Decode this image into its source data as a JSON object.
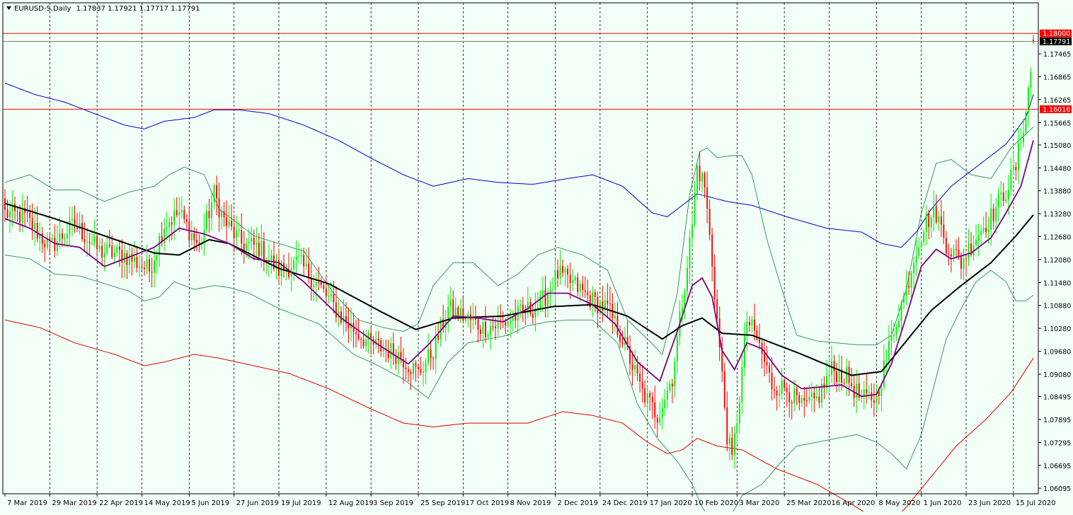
{
  "chart_data": {
    "type": "candlestick",
    "symbol_label": "EURUSD-S,Daily",
    "ohlc_header": "1.17837 1.17921 1.17717 1.17791",
    "ylim": [
      1.0595,
      1.188
    ],
    "y_ticks": [
      "1.17465",
      "1.16865",
      "1.16265",
      "1.15665",
      "1.15080",
      "1.14480",
      "1.13880",
      "1.13280",
      "1.12680",
      "1.12080",
      "1.11480",
      "1.10880",
      "1.10280",
      "1.09680",
      "1.09080",
      "1.08495",
      "1.07895",
      "1.07295",
      "1.06695",
      "1.06095"
    ],
    "x_ticks": [
      "7 Mar 2019",
      "29 Mar 2019",
      "22 Apr 2019",
      "14 May 2019",
      "5 Jun 2019",
      "27 Jun 2019",
      "19 Jul 2019",
      "12 Aug 2019",
      "3 Sep 2019",
      "25 Sep 2019",
      "17 Oct 2019",
      "8 Nov 2019",
      "2 Dec 2019",
      "24 Dec 2019",
      "17 Jan 2020",
      "10 Feb 2020",
      "3 Mar 2020",
      "25 Mar 2020",
      "16 Apr 2020",
      "8 May 2020",
      "1 Jun 2020",
      "23 Jun 2020",
      "15 Jul 2020"
    ],
    "price_levels": [
      {
        "value": 1.18,
        "label": "1.18000",
        "color": "#ff0000"
      },
      {
        "value": 1.16016,
        "label": "1.16016",
        "color": "#ff0000"
      }
    ],
    "current_price": {
      "value": 1.17791,
      "label": "1.17791",
      "color": "#808080"
    },
    "colors": {
      "background": "#f2fff6",
      "bull": "#00ee00",
      "bear": "#ff0000",
      "bollinger": "#2e8b57",
      "ma_fast": "#800080",
      "ma_slow": "#000000",
      "envelope_upper": "#0000cc",
      "envelope_lower": "#dd0000"
    },
    "anchors": [
      [
        0,
        1.133
      ],
      [
        8,
        1.132
      ],
      [
        18,
        1.124
      ],
      [
        28,
        1.13
      ],
      [
        38,
        1.123
      ],
      [
        48,
        1.122
      ],
      [
        58,
        1.118
      ],
      [
        64,
        1.13
      ],
      [
        70,
        1.133
      ],
      [
        78,
        1.124
      ],
      [
        84,
        1.138
      ],
      [
        88,
        1.131
      ],
      [
        95,
        1.125
      ],
      [
        102,
        1.124
      ],
      [
        110,
        1.118
      ],
      [
        118,
        1.12
      ],
      [
        126,
        1.114
      ],
      [
        136,
        1.105
      ],
      [
        146,
        1.099
      ],
      [
        158,
        1.096
      ],
      [
        166,
        1.091
      ],
      [
        172,
        1.097
      ],
      [
        178,
        1.108
      ],
      [
        184,
        1.106
      ],
      [
        192,
        1.103
      ],
      [
        200,
        1.104
      ],
      [
        208,
        1.107
      ],
      [
        215,
        1.109
      ],
      [
        222,
        1.117
      ],
      [
        229,
        1.114
      ],
      [
        236,
        1.11
      ],
      [
        242,
        1.108
      ],
      [
        248,
        1.1
      ],
      [
        256,
        1.086
      ],
      [
        262,
        1.08
      ],
      [
        268,
        1.09
      ],
      [
        272,
        1.11
      ],
      [
        276,
        1.13
      ],
      [
        278,
        1.145
      ],
      [
        281,
        1.14
      ],
      [
        284,
        1.12
      ],
      [
        288,
        1.09
      ],
      [
        290,
        1.075
      ],
      [
        292,
        1.068
      ],
      [
        295,
        1.085
      ],
      [
        298,
        1.105
      ],
      [
        302,
        1.1
      ],
      [
        308,
        1.088
      ],
      [
        314,
        1.087
      ],
      [
        320,
        1.082
      ],
      [
        326,
        1.084
      ],
      [
        332,
        1.092
      ],
      [
        338,
        1.09
      ],
      [
        344,
        1.084
      ],
      [
        350,
        1.085
      ],
      [
        354,
        1.095
      ],
      [
        358,
        1.105
      ],
      [
        362,
        1.113
      ],
      [
        366,
        1.124
      ],
      [
        370,
        1.131
      ],
      [
        374,
        1.133
      ],
      [
        378,
        1.125
      ],
      [
        384,
        1.12
      ],
      [
        390,
        1.127
      ],
      [
        396,
        1.132
      ],
      [
        402,
        1.139
      ],
      [
        406,
        1.145
      ],
      [
        410,
        1.16
      ],
      [
        412,
        1.17
      ],
      [
        413,
        1.1779
      ]
    ],
    "ma_fast_pts": [
      [
        0,
        1.1315
      ],
      [
        10,
        1.129
      ],
      [
        20,
        1.125
      ],
      [
        30,
        1.124
      ],
      [
        40,
        1.119
      ],
      [
        50,
        1.1215
      ],
      [
        60,
        1.124
      ],
      [
        70,
        1.129
      ],
      [
        80,
        1.1275
      ],
      [
        90,
        1.125
      ],
      [
        100,
        1.121
      ],
      [
        110,
        1.12
      ],
      [
        120,
        1.115
      ],
      [
        135,
        1.1055
      ],
      [
        150,
        1.0985
      ],
      [
        162,
        1.0935
      ],
      [
        170,
        1.0985
      ],
      [
        180,
        1.106
      ],
      [
        190,
        1.1055
      ],
      [
        200,
        1.1045
      ],
      [
        210,
        1.108
      ],
      [
        218,
        1.112
      ],
      [
        226,
        1.112
      ],
      [
        236,
        1.109
      ],
      [
        245,
        1.104
      ],
      [
        254,
        1.094
      ],
      [
        263,
        1.089
      ],
      [
        270,
        1.102
      ],
      [
        276,
        1.114
      ],
      [
        280,
        1.116
      ],
      [
        284,
        1.111
      ],
      [
        288,
        1.097
      ],
      [
        293,
        1.092
      ],
      [
        298,
        1.099
      ],
      [
        304,
        1.0975
      ],
      [
        312,
        1.0905
      ],
      [
        320,
        1.087
      ],
      [
        328,
        1.0875
      ],
      [
        336,
        1.088
      ],
      [
        344,
        1.085
      ],
      [
        350,
        1.0855
      ],
      [
        356,
        1.0935
      ],
      [
        362,
        1.106
      ],
      [
        368,
        1.119
      ],
      [
        374,
        1.1235
      ],
      [
        380,
        1.121
      ],
      [
        388,
        1.1225
      ],
      [
        396,
        1.1265
      ],
      [
        402,
        1.133
      ],
      [
        408,
        1.14
      ],
      [
        413,
        1.152
      ]
    ],
    "ma_slow_pts": [
      [
        0,
        1.1355
      ],
      [
        20,
        1.1315
      ],
      [
        40,
        1.127
      ],
      [
        60,
        1.1225
      ],
      [
        70,
        1.122
      ],
      [
        82,
        1.126
      ],
      [
        90,
        1.125
      ],
      [
        110,
        1.1185
      ],
      [
        130,
        1.1145
      ],
      [
        150,
        1.1075
      ],
      [
        165,
        1.1025
      ],
      [
        180,
        1.1055
      ],
      [
        200,
        1.106
      ],
      [
        220,
        1.1085
      ],
      [
        236,
        1.109
      ],
      [
        250,
        1.106
      ],
      [
        264,
        1.1
      ],
      [
        272,
        1.1035
      ],
      [
        280,
        1.1055
      ],
      [
        288,
        1.1015
      ],
      [
        300,
        1.101
      ],
      [
        320,
        1.096
      ],
      [
        340,
        1.0905
      ],
      [
        352,
        1.0915
      ],
      [
        362,
        1.0995
      ],
      [
        372,
        1.1075
      ],
      [
        384,
        1.114
      ],
      [
        396,
        1.12
      ],
      [
        406,
        1.127
      ],
      [
        413,
        1.1325
      ]
    ],
    "bb_upper_pts": [
      [
        0,
        1.141
      ],
      [
        10,
        1.143
      ],
      [
        20,
        1.139
      ],
      [
        30,
        1.139
      ],
      [
        40,
        1.136
      ],
      [
        50,
        1.1385
      ],
      [
        60,
        1.14
      ],
      [
        66,
        1.143
      ],
      [
        72,
        1.145
      ],
      [
        80,
        1.143
      ],
      [
        86,
        1.134
      ],
      [
        92,
        1.131
      ],
      [
        100,
        1.127
      ],
      [
        110,
        1.125
      ],
      [
        120,
        1.123
      ],
      [
        132,
        1.112
      ],
      [
        142,
        1.105
      ],
      [
        152,
        1.103
      ],
      [
        160,
        1.102
      ],
      [
        166,
        1.104
      ],
      [
        172,
        1.114
      ],
      [
        180,
        1.12
      ],
      [
        188,
        1.12
      ],
      [
        198,
        1.114
      ],
      [
        206,
        1.117
      ],
      [
        214,
        1.122
      ],
      [
        222,
        1.124
      ],
      [
        232,
        1.122
      ],
      [
        242,
        1.118
      ],
      [
        250,
        1.105
      ],
      [
        258,
        1.1
      ],
      [
        264,
        1.096
      ],
      [
        270,
        1.112
      ],
      [
        275,
        1.138
      ],
      [
        279,
        1.149
      ],
      [
        282,
        1.15
      ],
      [
        286,
        1.1475
      ],
      [
        292,
        1.148
      ],
      [
        296,
        1.148
      ],
      [
        300,
        1.143
      ],
      [
        306,
        1.126
      ],
      [
        312,
        1.113
      ],
      [
        318,
        1.101
      ],
      [
        326,
        1.0995
      ],
      [
        334,
        1.099
      ],
      [
        342,
        1.0985
      ],
      [
        350,
        1.0985
      ],
      [
        356,
        1.101
      ],
      [
        362,
        1.113
      ],
      [
        368,
        1.133
      ],
      [
        374,
        1.146
      ],
      [
        380,
        1.147
      ],
      [
        388,
        1.143
      ],
      [
        396,
        1.142
      ],
      [
        404,
        1.15
      ],
      [
        413,
        1.1555
      ]
    ],
    "bb_lower_pts": [
      [
        0,
        1.122
      ],
      [
        10,
        1.121
      ],
      [
        20,
        1.117
      ],
      [
        30,
        1.1165
      ],
      [
        40,
        1.1145
      ],
      [
        50,
        1.1125
      ],
      [
        56,
        1.11
      ],
      [
        62,
        1.111
      ],
      [
        68,
        1.115
      ],
      [
        76,
        1.113
      ],
      [
        84,
        1.114
      ],
      [
        90,
        1.1135
      ],
      [
        98,
        1.112
      ],
      [
        110,
        1.108
      ],
      [
        126,
        1.104
      ],
      [
        140,
        1.096
      ],
      [
        150,
        1.093
      ],
      [
        160,
        1.0895
      ],
      [
        170,
        1.0845
      ],
      [
        178,
        1.094
      ],
      [
        186,
        1.099
      ],
      [
        194,
        1.1
      ],
      [
        202,
        1.101
      ],
      [
        210,
        1.1035
      ],
      [
        218,
        1.1045
      ],
      [
        226,
        1.105
      ],
      [
        236,
        1.105
      ],
      [
        246,
        1.099
      ],
      [
        254,
        1.083
      ],
      [
        262,
        1.074
      ],
      [
        270,
        1.068
      ],
      [
        276,
        1.062
      ],
      [
        280,
        1.056
      ],
      [
        284,
        1.052
      ],
      [
        290,
        1.052
      ],
      [
        296,
        1.059
      ],
      [
        304,
        1.062
      ],
      [
        312,
        1.068
      ],
      [
        318,
        1.072
      ],
      [
        326,
        1.073
      ],
      [
        334,
        1.074
      ],
      [
        342,
        1.075
      ],
      [
        350,
        1.073
      ],
      [
        356,
        1.07
      ],
      [
        362,
        1.066
      ],
      [
        368,
        1.075
      ],
      [
        374,
        1.09
      ],
      [
        378,
        1.1
      ],
      [
        384,
        1.108
      ],
      [
        390,
        1.115
      ],
      [
        396,
        1.118
      ],
      [
        402,
        1.115
      ],
      [
        406,
        1.11
      ],
      [
        410,
        1.11
      ],
      [
        413,
        1.1115
      ]
    ],
    "env_upper_pts": [
      [
        0,
        1.167
      ],
      [
        12,
        1.164
      ],
      [
        24,
        1.162
      ],
      [
        36,
        1.159
      ],
      [
        48,
        1.156
      ],
      [
        56,
        1.155
      ],
      [
        64,
        1.157
      ],
      [
        76,
        1.158
      ],
      [
        84,
        1.16
      ],
      [
        94,
        1.16
      ],
      [
        106,
        1.159
      ],
      [
        120,
        1.156
      ],
      [
        134,
        1.152
      ],
      [
        148,
        1.147
      ],
      [
        160,
        1.143
      ],
      [
        172,
        1.14
      ],
      [
        186,
        1.142
      ],
      [
        198,
        1.141
      ],
      [
        212,
        1.1405
      ],
      [
        226,
        1.142
      ],
      [
        236,
        1.143
      ],
      [
        248,
        1.14
      ],
      [
        260,
        1.133
      ],
      [
        266,
        1.132
      ],
      [
        272,
        1.135
      ],
      [
        278,
        1.138
      ],
      [
        284,
        1.137
      ],
      [
        290,
        1.136
      ],
      [
        300,
        1.135
      ],
      [
        314,
        1.132
      ],
      [
        330,
        1.129
      ],
      [
        344,
        1.128
      ],
      [
        352,
        1.125
      ],
      [
        360,
        1.124
      ],
      [
        366,
        1.128
      ],
      [
        372,
        1.134
      ],
      [
        380,
        1.14
      ],
      [
        392,
        1.146
      ],
      [
        402,
        1.151
      ],
      [
        410,
        1.158
      ],
      [
        413,
        1.164
      ]
    ],
    "env_lower_pts": [
      [
        0,
        1.105
      ],
      [
        14,
        1.103
      ],
      [
        28,
        1.099
      ],
      [
        44,
        1.096
      ],
      [
        56,
        1.093
      ],
      [
        64,
        1.094
      ],
      [
        76,
        1.096
      ],
      [
        86,
        1.095
      ],
      [
        100,
        1.093
      ],
      [
        114,
        1.091
      ],
      [
        130,
        1.087
      ],
      [
        146,
        1.082
      ],
      [
        160,
        1.078
      ],
      [
        172,
        1.077
      ],
      [
        186,
        1.078
      ],
      [
        198,
        1.078
      ],
      [
        210,
        1.078
      ],
      [
        224,
        1.081
      ],
      [
        236,
        1.08
      ],
      [
        248,
        1.078
      ],
      [
        258,
        1.073
      ],
      [
        266,
        1.07
      ],
      [
        272,
        1.071
      ],
      [
        278,
        1.074
      ],
      [
        286,
        1.072
      ],
      [
        296,
        1.071
      ],
      [
        310,
        1.066
      ],
      [
        326,
        1.062
      ],
      [
        342,
        1.056
      ],
      [
        354,
        1.051
      ],
      [
        362,
        1.056
      ],
      [
        372,
        1.064
      ],
      [
        382,
        1.072
      ],
      [
        394,
        1.079
      ],
      [
        404,
        1.086
      ],
      [
        413,
        1.095
      ]
    ],
    "fast_window": 10
  }
}
